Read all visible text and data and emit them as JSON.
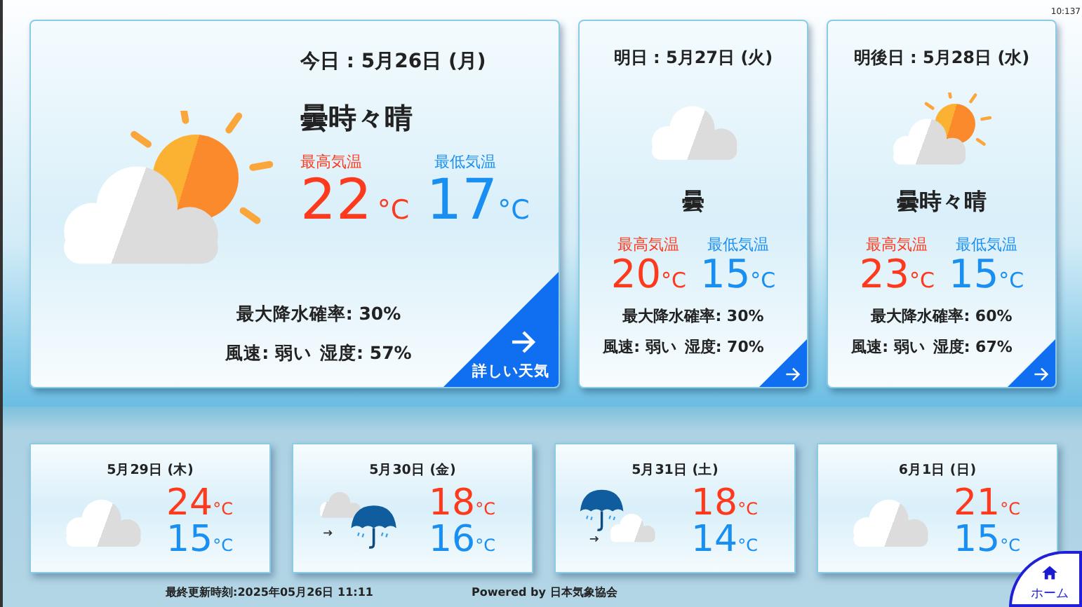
{
  "corner_label": "10:137",
  "today": {
    "date": "今日 : 5月26日 (月)",
    "kind": "cloudy_sunny",
    "condition": "曇時々晴",
    "high_label": "最高気温",
    "high": "22",
    "high_unit": "°C",
    "low_label": "最低気温",
    "low": "17",
    "low_unit": "°C",
    "precipitation": "最大降水確率: 30%",
    "wind": "風速: 弱い",
    "humidity": "湿度: 57%",
    "details": "詳しい天気"
  },
  "upcoming": [
    {
      "date": "明日 : 5月27日 (火)",
      "kind": "cloudy",
      "condition": "曇",
      "high_label": "最高気温",
      "high": "20",
      "high_unit": "°C",
      "low_label": "最低気温",
      "low": "15",
      "low_unit": "°C",
      "precipitation": "最大降水確率: 30%",
      "wind": "風速: 弱い",
      "humidity": "湿度: 70%"
    },
    {
      "date": "明後日 : 5月28日 (水)",
      "kind": "cloudy_sunny",
      "condition": "曇時々晴",
      "high_label": "最高気温",
      "high": "23",
      "high_unit": "°C",
      "low_label": "最低気温",
      "low": "15",
      "low_unit": "°C",
      "precipitation": "最大降水確率: 60%",
      "wind": "風速: 弱い",
      "humidity": "湿度: 67%"
    }
  ],
  "weekly": [
    {
      "date": "5月29日 (木)",
      "kind": "cloudy",
      "high": "24",
      "high_unit": "°C",
      "low": "15",
      "low_unit": "°C"
    },
    {
      "date": "5月30日 (金)",
      "kind": "cloudy_then_rain",
      "high": "18",
      "high_unit": "°C",
      "low": "16",
      "low_unit": "°C"
    },
    {
      "date": "5月31日 (土)",
      "kind": "rain_then_cloudy",
      "high": "18",
      "high_unit": "°C",
      "low": "14",
      "low_unit": "°C"
    },
    {
      "date": "6月1日 (日)",
      "kind": "cloudy",
      "high": "21",
      "high_unit": "°C",
      "low": "15",
      "low_unit": "°C"
    }
  ],
  "footer": {
    "updated": "最終更新時刻:2025年05月26日 11:11",
    "powered": "Powered by 日本気象協会"
  },
  "home_button": {
    "label": "ホーム"
  }
}
